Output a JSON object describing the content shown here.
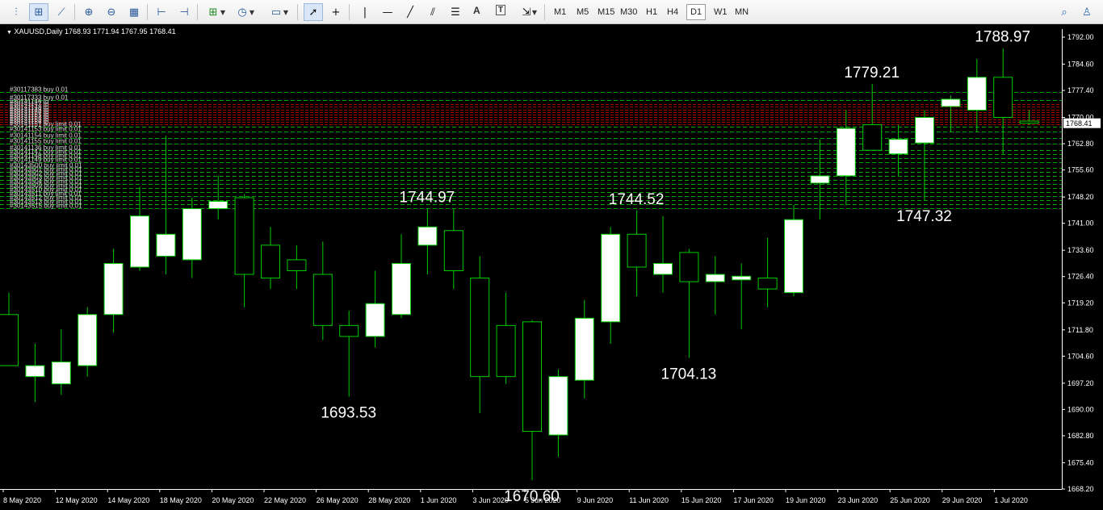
{
  "toolbar": {
    "timeframes": [
      "M1",
      "M5",
      "M15",
      "M30",
      "H1",
      "H4",
      "D1",
      "W1",
      "MN"
    ],
    "active_timeframe": "D1",
    "text_tool": "A",
    "text_label_tool": "T"
  },
  "symbol_info": "XAUUSD,Daily  1768.93 1771.94 1767.95 1768.41",
  "colors": {
    "background": "#000000",
    "bull_body": "#ffffff",
    "wick": "#00cc00",
    "axis": "#ffffff",
    "order_line": "#00aa00",
    "active_order_line": "#aa0000",
    "price_tag_bg": "#ffffff"
  },
  "chart_data": {
    "type": "candlestick",
    "ylim": [
      1668.2,
      1792.0
    ],
    "y_ticks": [
      "1792.00",
      "1784.60",
      "1777.40",
      "1770.00",
      "1762.80",
      "1755.60",
      "1748.20",
      "1741.00",
      "1733.60",
      "1726.40",
      "1719.20",
      "1711.80",
      "1704.60",
      "1697.20",
      "1690.00",
      "1682.80",
      "1675.40",
      "1668.20"
    ],
    "x_labels": [
      "8 May 2020",
      "12 May 2020",
      "14 May 2020",
      "18 May 2020",
      "20 May 2020",
      "22 May 2020",
      "26 May 2020",
      "28 May 2020",
      "1 Jun 2020",
      "3 Jun 2020",
      "5 Jun 2020",
      "9 Jun 2020",
      "11 Jun 2020",
      "15 Jun 2020",
      "17 Jun 2020",
      "19 Jun 2020",
      "23 Jun 2020",
      "25 Jun 2020",
      "29 Jun 2020",
      "1 Jul 2020"
    ],
    "current_price": "1768.41",
    "candles": [
      {
        "o": 1716.0,
        "h": 1722.0,
        "l": 1702.0,
        "c": 1702.0
      },
      {
        "o": 1699.0,
        "h": 1708.0,
        "l": 1692.0,
        "c": 1702.0
      },
      {
        "o": 1697.0,
        "h": 1712.0,
        "l": 1694.0,
        "c": 1703.0
      },
      {
        "o": 1702.0,
        "h": 1718.0,
        "l": 1699.0,
        "c": 1716.0
      },
      {
        "o": 1716.0,
        "h": 1734.0,
        "l": 1711.0,
        "c": 1730.0
      },
      {
        "o": 1729.0,
        "h": 1751.0,
        "l": 1728.0,
        "c": 1743.0
      },
      {
        "o": 1732.0,
        "h": 1765.0,
        "l": 1727.0,
        "c": 1738.0
      },
      {
        "o": 1731.0,
        "h": 1748.0,
        "l": 1726.0,
        "c": 1745.0
      },
      {
        "o": 1745.0,
        "h": 1754.0,
        "l": 1742.0,
        "c": 1747.0
      },
      {
        "o": 1748.0,
        "h": 1749.0,
        "l": 1718.0,
        "c": 1727.0
      },
      {
        "o": 1735.0,
        "h": 1740.0,
        "l": 1723.0,
        "c": 1726.0
      },
      {
        "o": 1731.0,
        "h": 1735.0,
        "l": 1723.0,
        "c": 1728.0
      },
      {
        "o": 1727.0,
        "h": 1736.0,
        "l": 1709.0,
        "c": 1713.0
      },
      {
        "o": 1713.0,
        "h": 1717.0,
        "l": 1693.53,
        "c": 1710.0
      },
      {
        "o": 1710.0,
        "h": 1728.0,
        "l": 1707.0,
        "c": 1719.0
      },
      {
        "o": 1716.0,
        "h": 1738.0,
        "l": 1715.0,
        "c": 1730.0
      },
      {
        "o": 1735.0,
        "h": 1744.97,
        "l": 1727.0,
        "c": 1740.0
      },
      {
        "o": 1739.0,
        "h": 1744.97,
        "l": 1723.0,
        "c": 1728.0
      },
      {
        "o": 1726.0,
        "h": 1732.0,
        "l": 1689.0,
        "c": 1699.0
      },
      {
        "o": 1713.0,
        "h": 1722.0,
        "l": 1697.0,
        "c": 1699.0
      },
      {
        "o": 1714.0,
        "h": 1714.5,
        "l": 1670.6,
        "c": 1684.0
      },
      {
        "o": 1683.0,
        "h": 1701.0,
        "l": 1677.0,
        "c": 1699.0
      },
      {
        "o": 1698.0,
        "h": 1720.0,
        "l": 1693.0,
        "c": 1715.0
      },
      {
        "o": 1714.0,
        "h": 1740.0,
        "l": 1708.0,
        "c": 1738.0
      },
      {
        "o": 1738.0,
        "h": 1744.52,
        "l": 1721.0,
        "c": 1729.0
      },
      {
        "o": 1727.0,
        "h": 1743.0,
        "l": 1722.0,
        "c": 1730.0
      },
      {
        "o": 1733.0,
        "h": 1734.0,
        "l": 1704.13,
        "c": 1725.0
      },
      {
        "o": 1725.0,
        "h": 1732.0,
        "l": 1716.0,
        "c": 1727.0
      },
      {
        "o": 1725.5,
        "h": 1730.0,
        "l": 1712.0,
        "c": 1726.5
      },
      {
        "o": 1726.0,
        "h": 1737.0,
        "l": 1718.0,
        "c": 1723.0
      },
      {
        "o": 1722.0,
        "h": 1746.0,
        "l": 1721.0,
        "c": 1742.0
      },
      {
        "o": 1752.0,
        "h": 1764.0,
        "l": 1742.0,
        "c": 1754.0
      },
      {
        "o": 1754.0,
        "h": 1772.0,
        "l": 1746.0,
        "c": 1767.0
      },
      {
        "o": 1768.0,
        "h": 1779.21,
        "l": 1761.0,
        "c": 1761.0
      },
      {
        "o": 1760.0,
        "h": 1768.0,
        "l": 1754.0,
        "c": 1764.0
      },
      {
        "o": 1763.0,
        "h": 1772.0,
        "l": 1747.32,
        "c": 1770.0
      },
      {
        "o": 1773.0,
        "h": 1776.0,
        "l": 1766.0,
        "c": 1775.0
      },
      {
        "o": 1772.0,
        "h": 1786.0,
        "l": 1766.0,
        "c": 1781.0
      },
      {
        "o": 1781.0,
        "h": 1788.97,
        "l": 1760.0,
        "c": 1770.0
      },
      {
        "o": 1769.0,
        "h": 1771.94,
        "l": 1767.95,
        "c": 1768.41
      }
    ],
    "annotations": [
      {
        "text": "1788.97",
        "candle": 38,
        "where": "above"
      },
      {
        "text": "1779.21",
        "candle": 33,
        "where": "above"
      },
      {
        "text": "1744.97",
        "candle": 16,
        "where": "above"
      },
      {
        "text": "1744.52",
        "candle": 24,
        "where": "above"
      },
      {
        "text": "1747.32",
        "candle": 35,
        "where": "below"
      },
      {
        "text": "1704.13",
        "candle": 26,
        "where": "below"
      },
      {
        "text": "1693.53",
        "candle": 13,
        "where": "below"
      },
      {
        "text": "1670.60",
        "candle": 20,
        "where": "below"
      }
    ],
    "order_lines": [
      {
        "price": 1777.0,
        "label": "#30117383 buy 0.01",
        "style": "green"
      },
      {
        "price": 1774.7,
        "label": "#30117333 buy 0.01",
        "style": "green"
      },
      {
        "price": 1773.6,
        "label": "#30141146 tp",
        "style": "red"
      },
      {
        "price": 1772.9,
        "label": "#30141147 tp",
        "style": "red"
      },
      {
        "price": 1772.2,
        "label": "#30141148 tp",
        "style": "red"
      },
      {
        "price": 1771.5,
        "label": "#30141149 tp",
        "style": "red"
      },
      {
        "price": 1770.8,
        "label": "#30141150 tp",
        "style": "red"
      },
      {
        "price": 1770.1,
        "label": "#30141151 tp",
        "style": "red"
      },
      {
        "price": 1769.4,
        "label": "#30141152 tp",
        "style": "red"
      },
      {
        "price": 1768.8,
        "label": "#30141153 tp",
        "style": "red"
      },
      {
        "price": 1768.2,
        "label": "#30141156 tp",
        "style": "red"
      },
      {
        "price": 1767.4,
        "label": "#30141151 buy limit 0.01",
        "style": "green"
      },
      {
        "price": 1766.1,
        "label": "#30141153 buy limit 0.01",
        "style": "green"
      },
      {
        "price": 1764.4,
        "label": "#30141154 buy limit 0.01",
        "style": "green"
      },
      {
        "price": 1762.9,
        "label": "#30141155 buy limit 0.01",
        "style": "green"
      },
      {
        "price": 1761.1,
        "label": "#30141136 buy limit 0.01",
        "style": "green"
      },
      {
        "price": 1760.0,
        "label": "#30141147 buy limit 0.01",
        "style": "green"
      },
      {
        "price": 1758.9,
        "label": "#30141148 buy limit 0.01",
        "style": "green"
      },
      {
        "price": 1757.8,
        "label": "#30141149 buy limit 0.01",
        "style": "green"
      },
      {
        "price": 1756.2,
        "label": "#30143500 buy limit 0.01",
        "style": "green"
      },
      {
        "price": 1755.1,
        "label": "#30143501 buy limit 0.01",
        "style": "green"
      },
      {
        "price": 1754.0,
        "label": "#30143502 buy limit 0.01",
        "style": "green"
      },
      {
        "price": 1752.9,
        "label": "#30143503 buy limit 0.01",
        "style": "green"
      },
      {
        "price": 1751.8,
        "label": "#30143504 buy limit 0.01",
        "style": "green"
      },
      {
        "price": 1750.7,
        "label": "#30143509 buy limit 0.01",
        "style": "green"
      },
      {
        "price": 1749.6,
        "label": "#30143510 buy limit 0.01",
        "style": "green"
      },
      {
        "price": 1748.5,
        "label": "#30143511 buy limit 0.01",
        "style": "green"
      },
      {
        "price": 1747.4,
        "label": "#30143512 buy limit 0.01",
        "style": "green"
      },
      {
        "price": 1746.3,
        "label": "#30143513 buy limit 0.01",
        "style": "green"
      },
      {
        "price": 1745.2,
        "label": "#30143515 buy limit 0.01",
        "style": "green"
      }
    ]
  }
}
